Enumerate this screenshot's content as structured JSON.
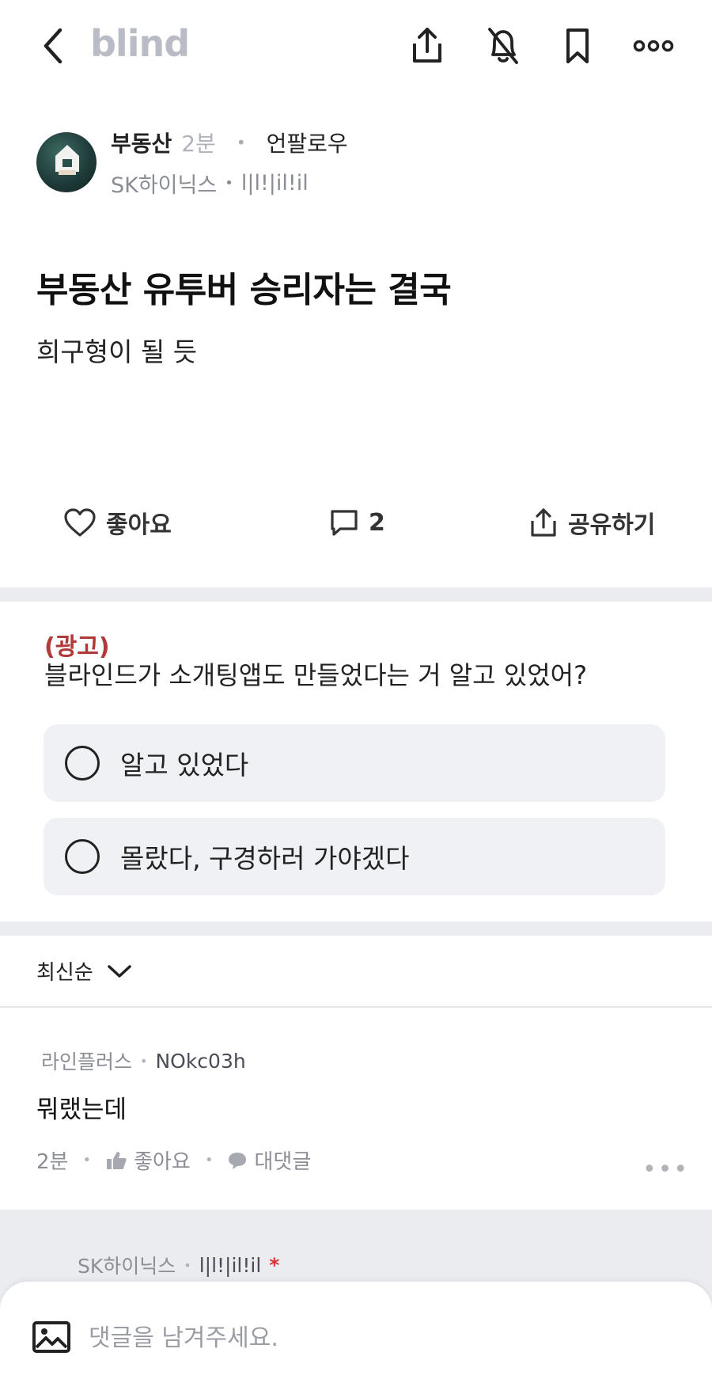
{
  "header": {
    "logo": "blind"
  },
  "author": {
    "name": "부동산",
    "time": "2분",
    "unfollow_label": "언팔로우",
    "company": "SK하이닉스",
    "handle": "l|l!|il!il"
  },
  "post": {
    "title": "부동산 유투버 승리자는 결국",
    "body": "희구형이 될 듯"
  },
  "actions": {
    "like_label": "좋아요",
    "comment_count": "2",
    "share_label": "공유하기"
  },
  "ad": {
    "tag": "(광고)",
    "question": "블라인드가 소개팅앱도 만들었다는 거 알고 있었어?",
    "options": [
      "알고 있었다",
      "몰랐다, 구경하러 가야겠다"
    ]
  },
  "sort": {
    "label": "최신순"
  },
  "comments": [
    {
      "company": "라인플러스",
      "handle": "NOkc03h",
      "body": "뭐랬는데",
      "time": "2분",
      "like_label": "좋아요",
      "reply_label": "대댓글"
    }
  ],
  "reply": {
    "company": "SK하이닉스",
    "handle": "l|l!|il!il",
    "marker": "*"
  },
  "comment_input": {
    "placeholder": "댓글을 남겨주세요."
  },
  "colors": {
    "ad_tag": "#b03a3a",
    "logo": "#b9bcc4",
    "divider": "#ebecf0",
    "poll_bg": "#f0f1f4",
    "author_marker": "#dd3333"
  }
}
